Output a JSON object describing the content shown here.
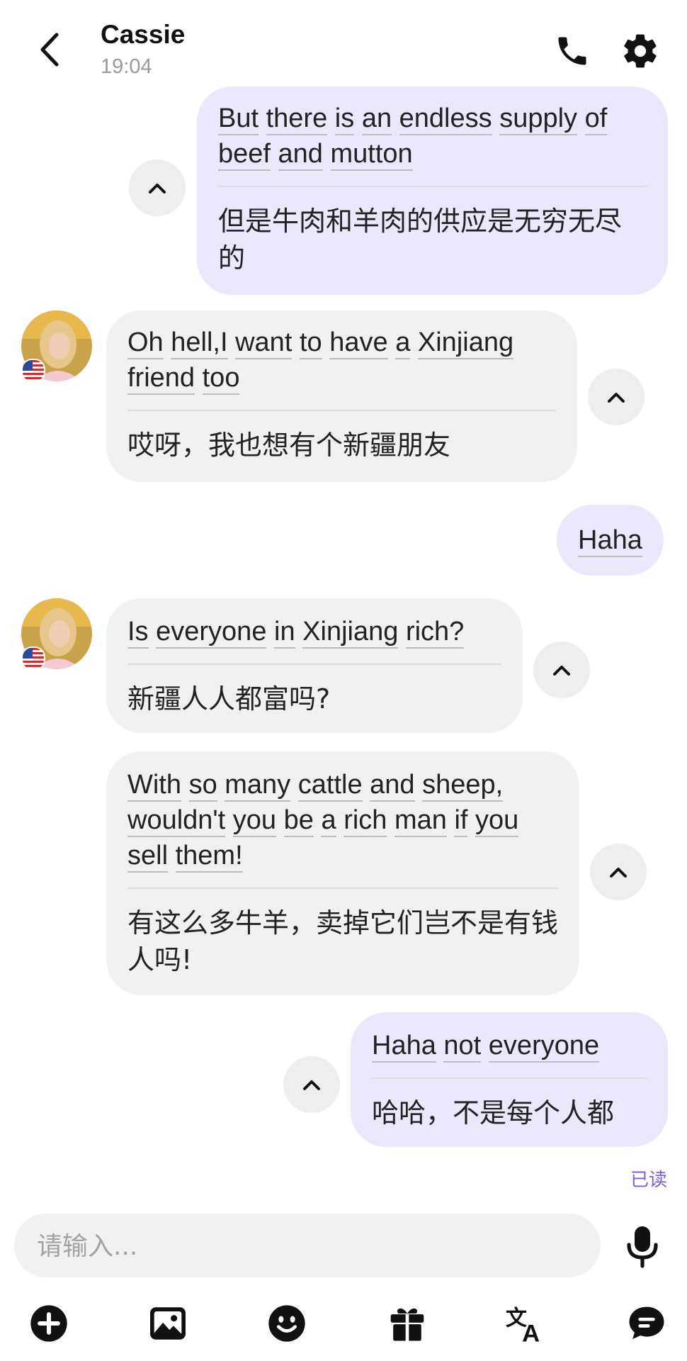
{
  "header": {
    "contact_name": "Cassie",
    "time": "19:04"
  },
  "messages": [
    {
      "direction": "outgoing",
      "original": "But there is an endless supply of beef and mutton",
      "translation": "但是牛肉和羊肉的供应是无穷无尽的"
    },
    {
      "direction": "incoming",
      "original": "Oh hell,I want to have a Xinjiang friend too",
      "translation": "哎呀，我也想有个新疆朋友"
    },
    {
      "direction": "outgoing",
      "original": "Haha"
    },
    {
      "direction": "incoming",
      "original": "Is everyone in Xinjiang rich?",
      "translation": "新疆人人都富吗?"
    },
    {
      "direction": "incoming",
      "original": "With so many cattle and sheep, wouldn't you be a rich man if you sell them!",
      "translation": "有这么多牛羊，卖掉它们岂不是有钱人吗!"
    },
    {
      "direction": "outgoing",
      "original": "Haha not everyone",
      "translation": "哈哈，不是每个人都"
    }
  ],
  "status": {
    "read_label": "已读"
  },
  "composer": {
    "placeholder": "请输入..."
  },
  "icons": {
    "back": "chevron-left-icon",
    "call": "phone-icon",
    "settings": "gear-icon",
    "collapse": "chevron-up-icon",
    "mic": "microphone-icon",
    "toolbar": [
      "plus-circle-icon",
      "image-icon",
      "emoji-icon",
      "gift-icon",
      "translate-icon",
      "chat-bubble-icon"
    ]
  },
  "colors": {
    "outgoing_bubble": "#ebe8fb",
    "incoming_bubble": "#f1f1f1",
    "read_status": "#7b5ce6"
  }
}
